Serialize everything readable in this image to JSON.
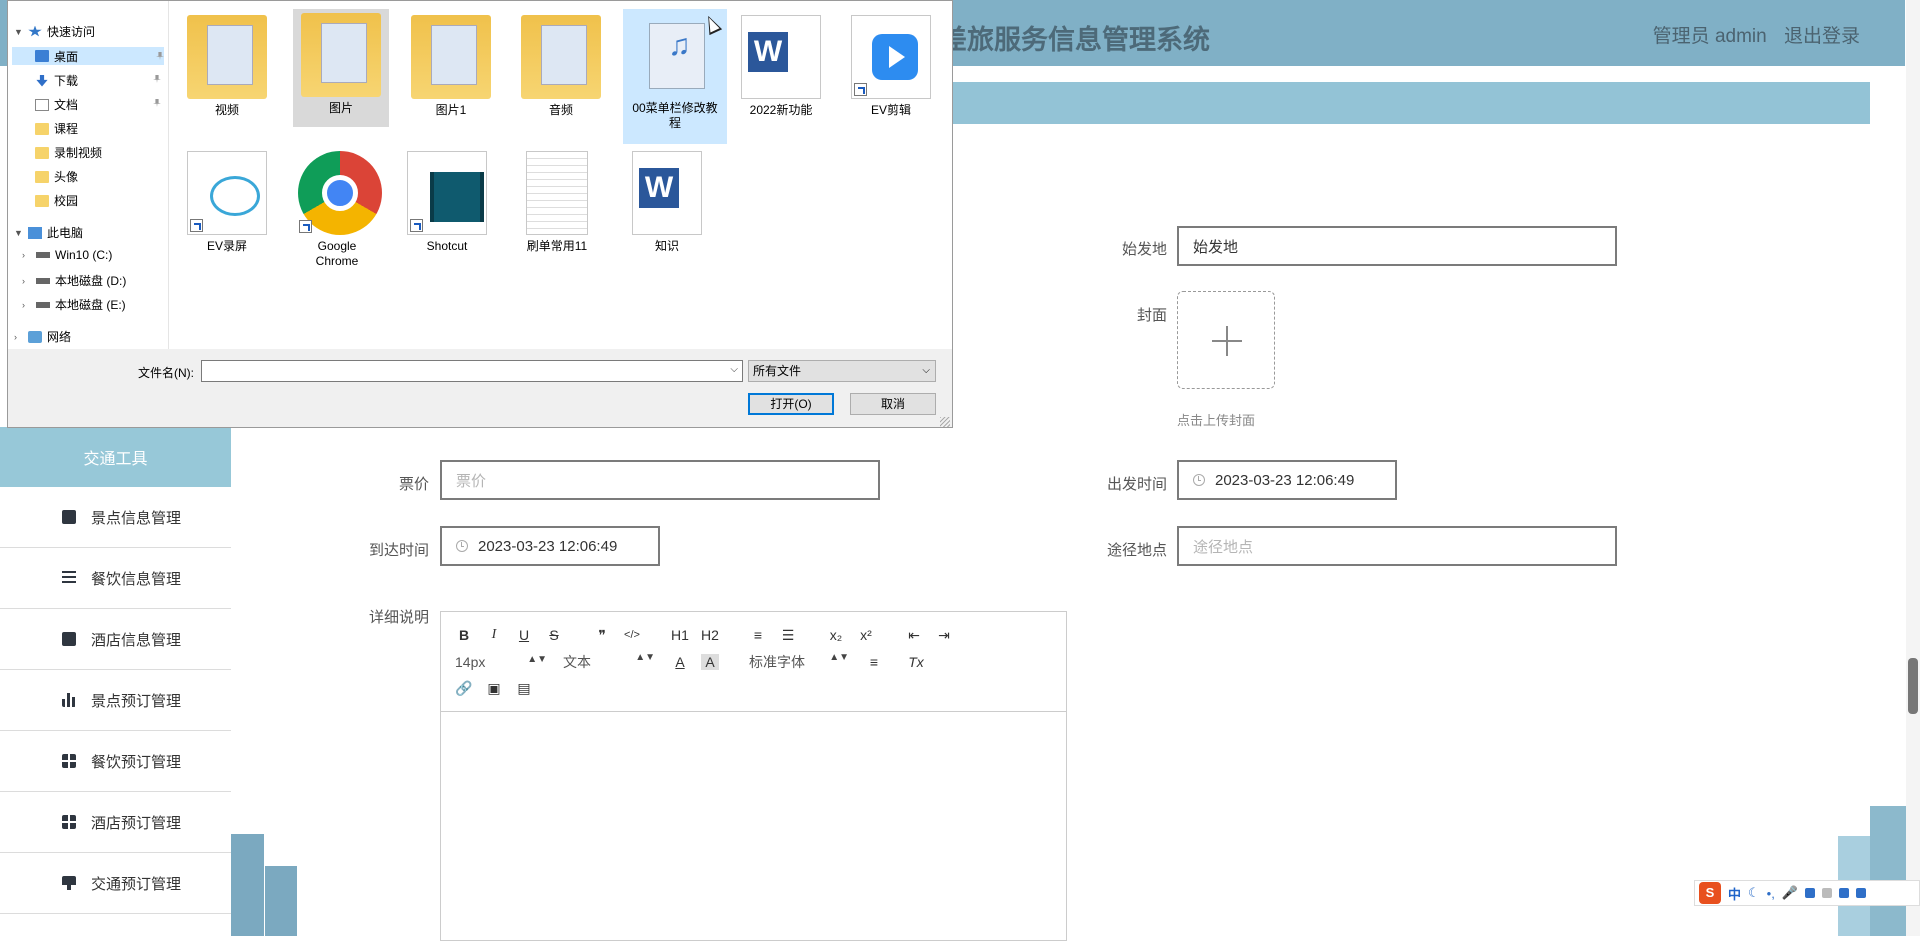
{
  "app": {
    "title": "差旅服务信息管理系统",
    "admin_label": "管理员 admin",
    "logout_label": "退出登录"
  },
  "sidebar": {
    "active_label": "交通工具",
    "items": [
      {
        "label": "景点信息管理",
        "icon": "clipboard-icon"
      },
      {
        "label": "餐饮信息管理",
        "icon": "list-icon"
      },
      {
        "label": "酒店信息管理",
        "icon": "clipboard-x-icon"
      },
      {
        "label": "景点预订管理",
        "icon": "bar-chart-icon"
      },
      {
        "label": "餐饮预订管理",
        "icon": "grid-icon"
      },
      {
        "label": "酒店预订管理",
        "icon": "grid-icon"
      },
      {
        "label": "交通预订管理",
        "icon": "monitor-icon"
      }
    ]
  },
  "form": {
    "origin_label": "始发地",
    "origin_value": "始发地",
    "cover_label": "封面",
    "cover_hint": "点击上传封面",
    "price_label": "票价",
    "price_placeholder": "票价",
    "depart_label": "出发时间",
    "depart_value": "2023-03-23 12:06:49",
    "arrive_label": "到达时间",
    "arrive_value": "2023-03-23 12:06:49",
    "route_label": "途径地点",
    "route_placeholder": "途径地点",
    "detail_label": "详细说明"
  },
  "editor": {
    "row1": [
      "B",
      "I",
      "U",
      "S",
      "❞",
      "</>",
      "H1",
      "H2",
      "≡",
      "☰",
      "x₂",
      "x²",
      "⇤",
      "⇥"
    ],
    "font_size": "14px",
    "header_select": "文本",
    "font_family": "标准字体",
    "row2_icons": [
      "A",
      "A",
      "≡",
      "Tx"
    ],
    "row3": [
      "🔗",
      "▣",
      "▤"
    ]
  },
  "dialog": {
    "nav": [
      {
        "label": "快速访问",
        "icon": "star-icon",
        "type": "group"
      },
      {
        "label": "桌面",
        "icon": "desktop-icon",
        "selected": true,
        "pinned": true
      },
      {
        "label": "下载",
        "icon": "download-icon",
        "pinned": true
      },
      {
        "label": "文档",
        "icon": "document-icon",
        "pinned": true
      },
      {
        "label": "课程",
        "icon": "folder-icon"
      },
      {
        "label": "录制视频",
        "icon": "folder-icon"
      },
      {
        "label": "头像",
        "icon": "folder-icon"
      },
      {
        "label": "校园",
        "icon": "folder-icon"
      },
      {
        "label": "此电脑",
        "icon": "computer-icon",
        "type": "group"
      },
      {
        "label": "Win10 (C:)",
        "icon": "drive-icon"
      },
      {
        "label": "本地磁盘 (D:)",
        "icon": "drive-icon"
      },
      {
        "label": "本地磁盘 (E:)",
        "icon": "drive-icon"
      },
      {
        "label": "网络",
        "icon": "network-icon",
        "type": "group"
      }
    ],
    "files": [
      {
        "label": "视频",
        "kind": "folder"
      },
      {
        "label": "图片",
        "kind": "folder",
        "state": "hover"
      },
      {
        "label": "图片1",
        "kind": "folder"
      },
      {
        "label": "音频",
        "kind": "folder"
      },
      {
        "label": "00菜单栏修改教程",
        "kind": "video",
        "state": "selected"
      },
      {
        "label": "2022新功能",
        "kind": "word"
      },
      {
        "label": "EV剪辑",
        "kind": "app-play",
        "shortcut": true
      },
      {
        "label": "EV录屏",
        "kind": "app-ev",
        "shortcut": true
      },
      {
        "label": "Google Chrome",
        "kind": "chrome",
        "shortcut": true
      },
      {
        "label": "Shotcut",
        "kind": "app-shotcut",
        "shortcut": true
      },
      {
        "label": "刷单常用11",
        "kind": "text"
      },
      {
        "label": "知识",
        "kind": "word"
      }
    ],
    "filename_label": "文件名(N):",
    "filename_value": "",
    "filetype_value": "所有文件",
    "open_label": "打开(O)",
    "cancel_label": "取消"
  },
  "ime": {
    "logo": "S",
    "mode": "中"
  },
  "colors": {
    "topbar": "#80b0c6",
    "subbar": "#93c3d6",
    "sidebar_active": "#97c8d8",
    "dialog_selected": "#cce8ff"
  }
}
